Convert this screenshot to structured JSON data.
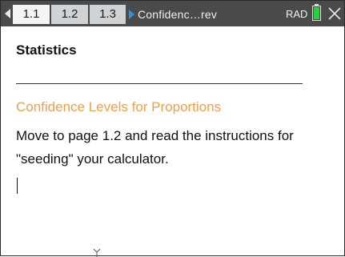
{
  "tabbar": {
    "tabs": [
      {
        "label": "1.1",
        "active": true
      },
      {
        "label": "1.2",
        "active": false
      },
      {
        "label": "1.3",
        "active": false
      }
    ],
    "doc_title": "Confidenc…rev",
    "mode": "RAD",
    "battery_level": 1.0,
    "icons": {
      "prev": "left-triangle-icon",
      "doc": "right-triangle-icon",
      "battery": "battery-icon",
      "close": "close-icon"
    }
  },
  "content": {
    "heading": "Statistics",
    "subheading": "Confidence Levels for Proportions",
    "body": "Move to page 1.2 and read the instructions for \"seeding\" your calculator."
  },
  "colors": {
    "tabbar_bg": "#4a4a4a",
    "accent_orange": "#f0a04b",
    "doc_arrow_blue": "#2f8fe0",
    "battery_green": "#2ecc40"
  }
}
